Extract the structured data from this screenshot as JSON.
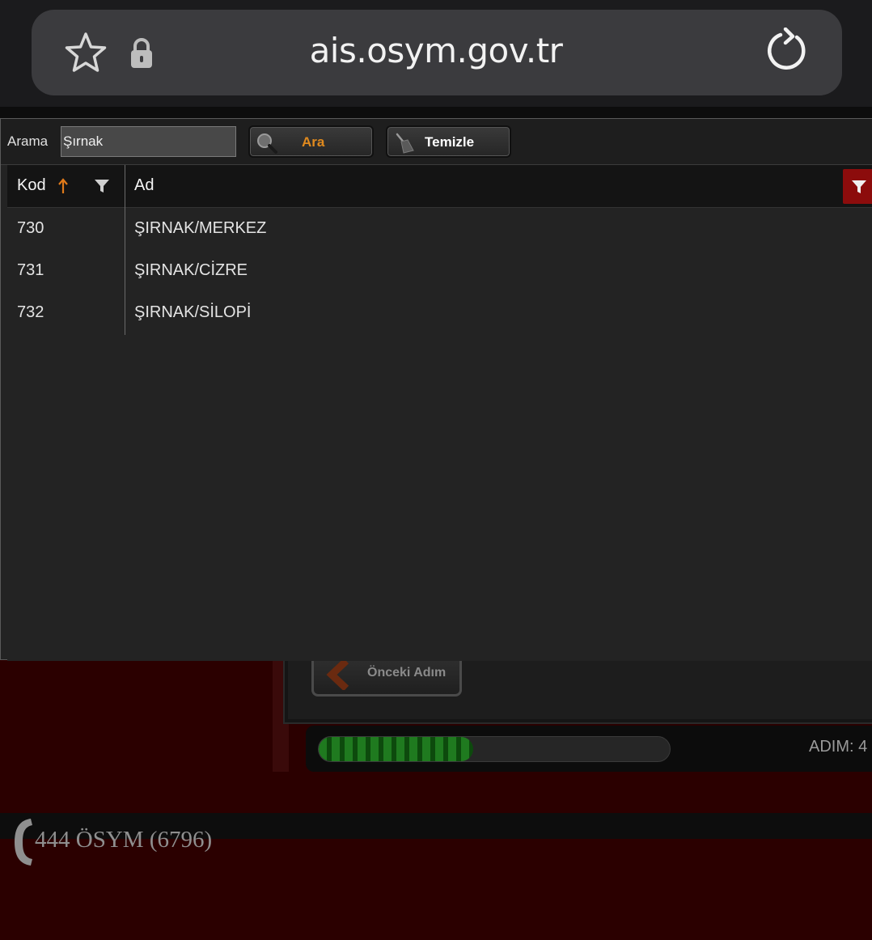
{
  "browser": {
    "url": "ais.osym.gov.tr",
    "icons": [
      "star-icon",
      "lock-icon",
      "reload-icon"
    ]
  },
  "search": {
    "label": "Arama",
    "value": "Şırnak",
    "search_button": "Ara",
    "clear_button": "Temizle"
  },
  "table": {
    "columns": [
      "Kod",
      "Ad"
    ],
    "sort": {
      "column": "Kod",
      "direction": "ascending"
    },
    "rows": [
      {
        "kod": "730",
        "ad": "ŞIRNAK/MERKEZ"
      },
      {
        "kod": "731",
        "ad": "ŞIRNAK/CİZRE"
      },
      {
        "kod": "732",
        "ad": "ŞIRNAK/SİLOPİ"
      }
    ]
  },
  "background": {
    "prev_button": "Önceki Adım",
    "progress_fraction": 0.44,
    "step_label": "ADIM:  4"
  },
  "footer": {
    "phone": "444 ÖSYM (6796)"
  },
  "colors": {
    "accent_orange": "#e08a1e",
    "filter_active_red": "#8c0c0c",
    "page_background": "#2b0000",
    "progress_green": "#1f7a1f"
  }
}
